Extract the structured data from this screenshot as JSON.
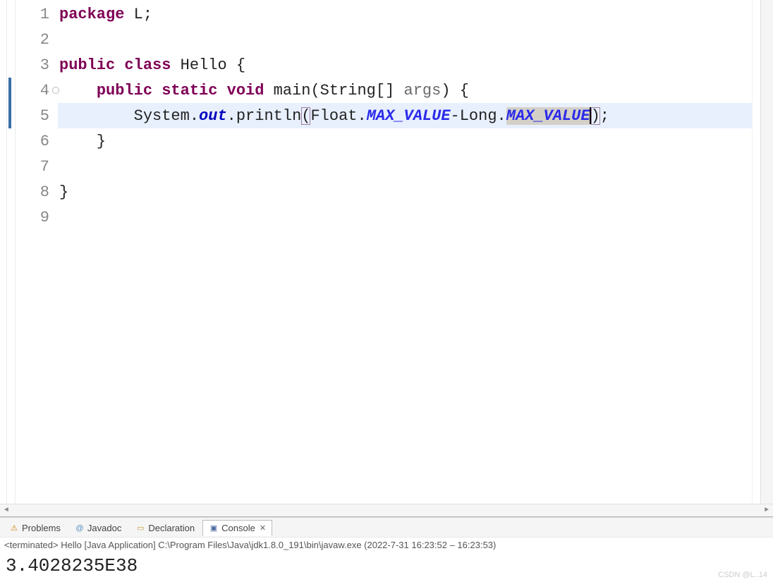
{
  "editor": {
    "lines": [
      {
        "num": "1",
        "marker": false,
        "tokens": [
          {
            "t": "package ",
            "c": "kw"
          },
          {
            "t": "L;",
            "c": "plain"
          }
        ]
      },
      {
        "num": "2",
        "marker": false,
        "tokens": []
      },
      {
        "num": "3",
        "marker": false,
        "tokens": [
          {
            "t": "public class ",
            "c": "kw"
          },
          {
            "t": "Hello {",
            "c": "plain"
          }
        ]
      },
      {
        "num": "4",
        "marker": true,
        "tokens": [
          {
            "t": "    ",
            "c": "plain"
          },
          {
            "t": "public static void ",
            "c": "kw"
          },
          {
            "t": "main(String[] ",
            "c": "plain"
          },
          {
            "t": "args",
            "c": "param"
          },
          {
            "t": ") {",
            "c": "plain"
          }
        ]
      },
      {
        "num": "5",
        "marker": false,
        "highlight": true,
        "tokens": [
          {
            "t": "        System.",
            "c": "plain"
          },
          {
            "t": "out",
            "c": "field-italic"
          },
          {
            "t": ".println",
            "c": "plain"
          },
          {
            "t": "(",
            "c": "plain",
            "bracket": true
          },
          {
            "t": "Float.",
            "c": "plain"
          },
          {
            "t": "MAX_VALUE",
            "c": "const-italic"
          },
          {
            "t": "-Long.",
            "c": "plain"
          },
          {
            "t": "MAX_VALUE",
            "c": "const-italic",
            "sel": true
          },
          {
            "caret": true
          },
          {
            "t": ")",
            "c": "plain",
            "bracket": true
          },
          {
            "t": ";",
            "c": "plain"
          }
        ]
      },
      {
        "num": "6",
        "marker": false,
        "tokens": [
          {
            "t": "    }",
            "c": "plain"
          }
        ]
      },
      {
        "num": "7",
        "marker": false,
        "tokens": []
      },
      {
        "num": "8",
        "marker": false,
        "tokens": [
          {
            "t": "}",
            "c": "plain"
          }
        ]
      },
      {
        "num": "9",
        "marker": false,
        "tokens": []
      }
    ]
  },
  "tabs": {
    "problems": "Problems",
    "javadoc": "Javadoc",
    "declaration": "Declaration",
    "console": "Console"
  },
  "console": {
    "header": "<terminated> Hello [Java Application] C:\\Program Files\\Java\\jdk1.8.0_191\\bin\\javaw.exe  (2022-7-31 16:23:52 – 16:23:53)",
    "output": "3.4028235E38"
  },
  "watermark": "CSDN @L..14"
}
